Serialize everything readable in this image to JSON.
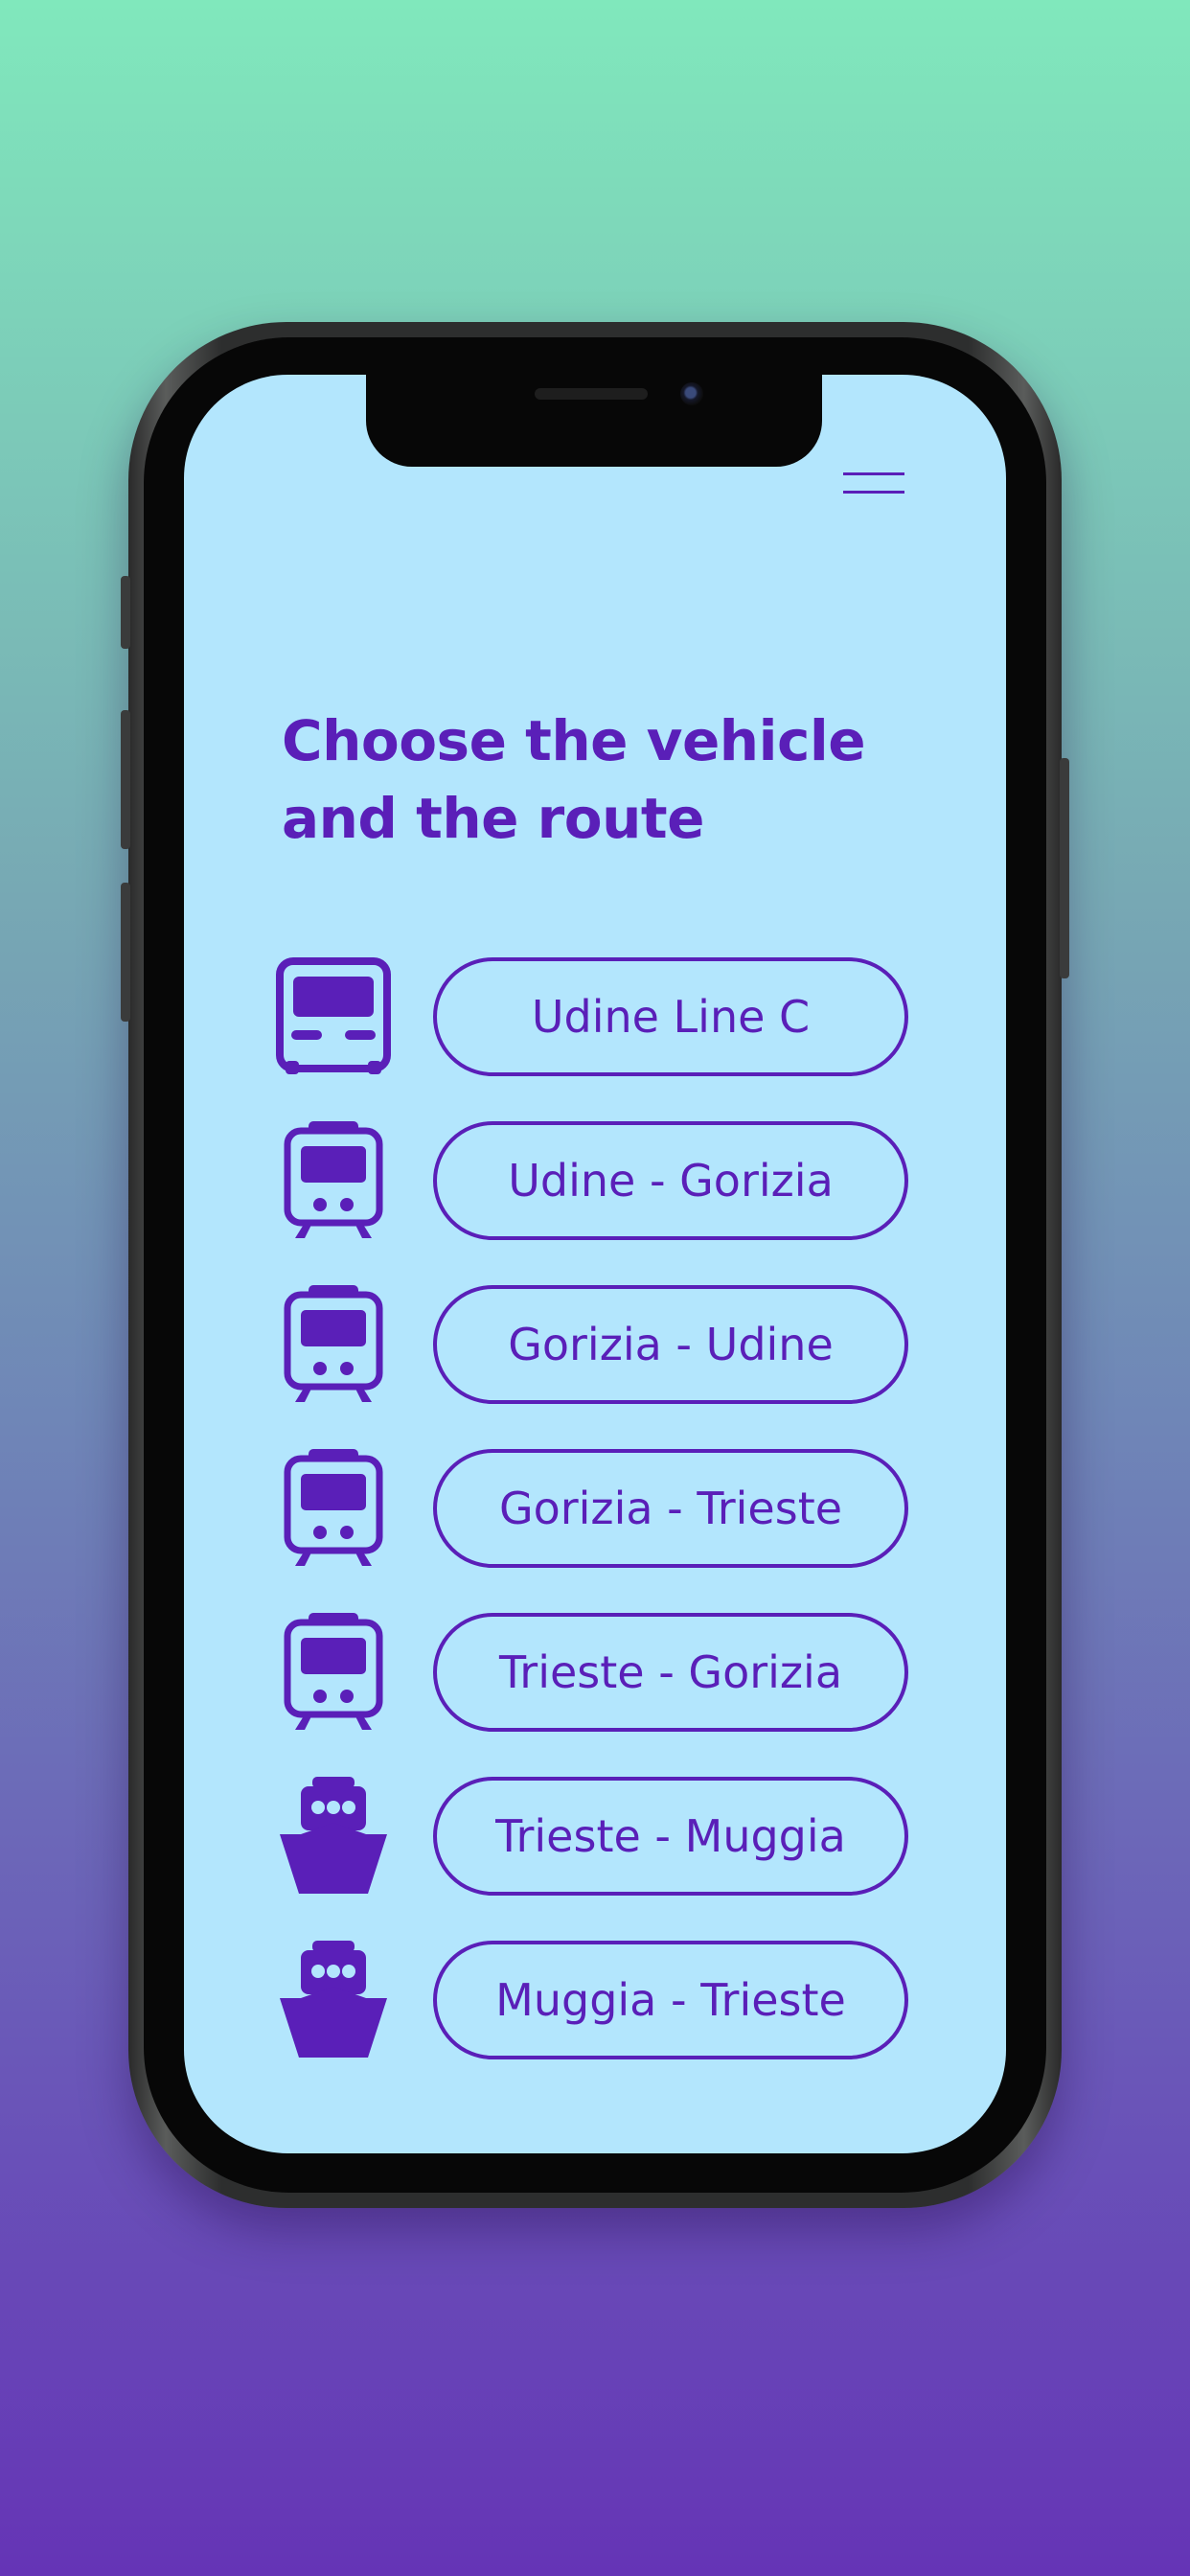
{
  "header": {
    "title": "Choose the vehicle\nand the route",
    "menu_icon": "hamburger-menu-icon"
  },
  "colors": {
    "accent": "#5a1fb8",
    "screen_background": "#b3e6fd",
    "gradient_top": "#80e8bc",
    "gradient_bottom": "#6534b6"
  },
  "routes": [
    {
      "vehicle": "bus",
      "icon": "bus-icon",
      "label": "Udine Line C"
    },
    {
      "vehicle": "train",
      "icon": "train-icon",
      "label": "Udine - Gorizia"
    },
    {
      "vehicle": "train",
      "icon": "train-icon",
      "label": "Gorizia - Udine"
    },
    {
      "vehicle": "train",
      "icon": "train-icon",
      "label": "Gorizia - Trieste"
    },
    {
      "vehicle": "train",
      "icon": "train-icon",
      "label": "Trieste - Gorizia"
    },
    {
      "vehicle": "ferry",
      "icon": "ferry-icon",
      "label": "Trieste - Muggia"
    },
    {
      "vehicle": "ferry",
      "icon": "ferry-icon",
      "label": "Muggia - Trieste"
    }
  ]
}
